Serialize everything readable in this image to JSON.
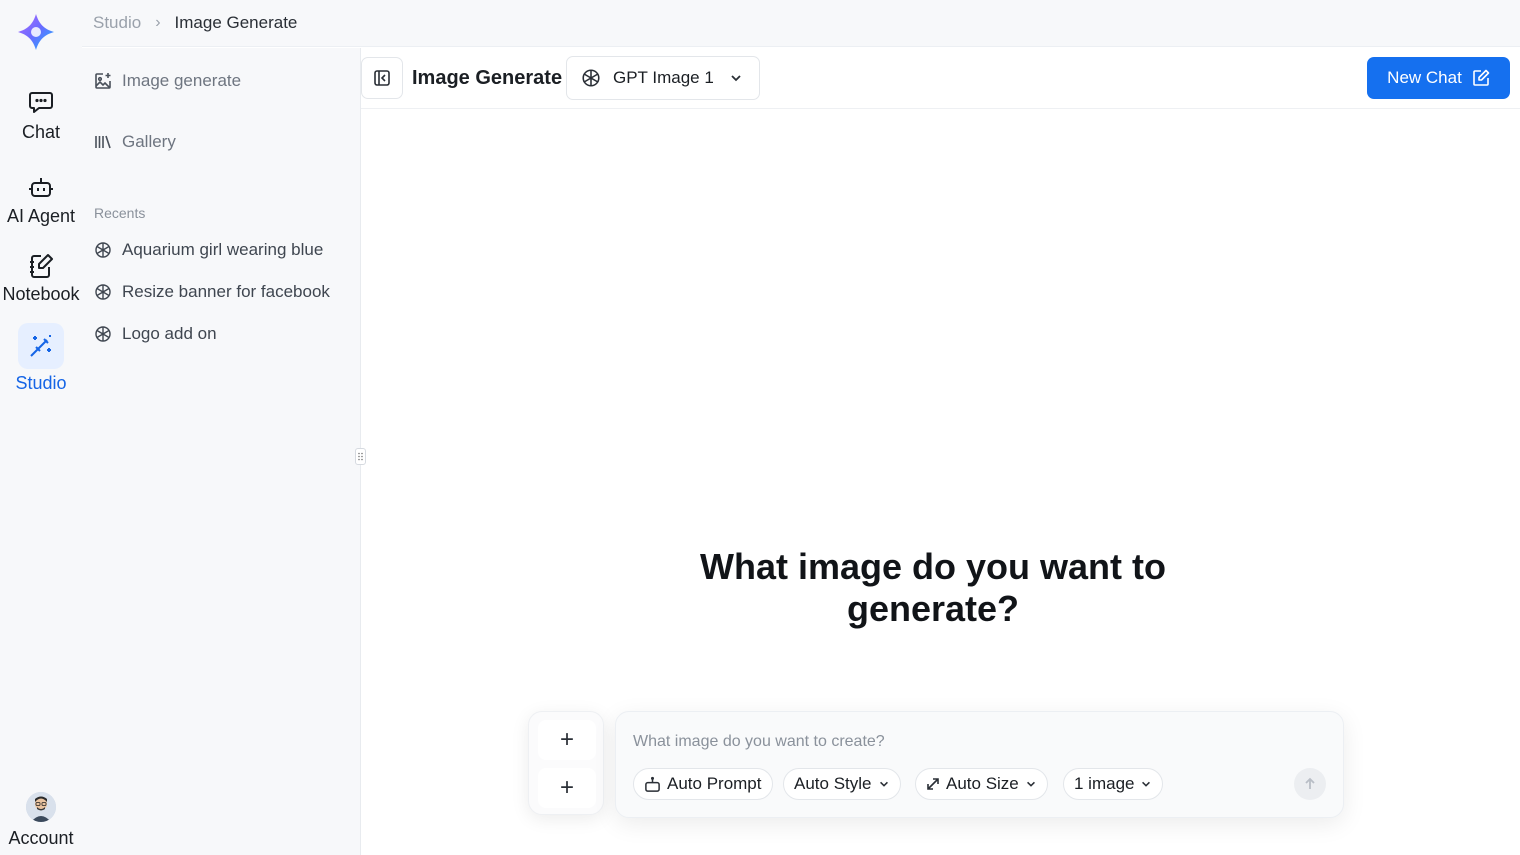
{
  "rail": {
    "items": [
      {
        "label": "Chat",
        "icon": "chat-icon"
      },
      {
        "label": "AI Agent",
        "icon": "robot-icon"
      },
      {
        "label": "Notebook",
        "icon": "notebook-icon"
      },
      {
        "label": "Studio",
        "icon": "magic-wand-icon"
      }
    ],
    "account_label": "Account",
    "active_color": "#1565e6"
  },
  "breadcrumb": {
    "parent": "Studio",
    "current": "Image Generate"
  },
  "sidebar": {
    "nav": [
      {
        "label": "Image generate",
        "icon": "image-edit-icon"
      },
      {
        "label": "Gallery",
        "icon": "library-icon"
      }
    ],
    "recents_label": "Recents",
    "recents": [
      {
        "label": "Aquarium girl wearing blue"
      },
      {
        "label": "Resize banner for facebook"
      },
      {
        "label": "Logo add on"
      }
    ]
  },
  "header": {
    "title": "Image Generate",
    "model": "GPT Image 1",
    "new_chat_label": "New Chat",
    "accent": "#1570ef"
  },
  "main": {
    "heading": "What image do you want to generate?"
  },
  "composer": {
    "placeholder": "What image do you want to create?",
    "auto_prompt": "Auto Prompt",
    "auto_style": "Auto Style",
    "auto_size": "Auto Size",
    "image_count": "1 image"
  }
}
